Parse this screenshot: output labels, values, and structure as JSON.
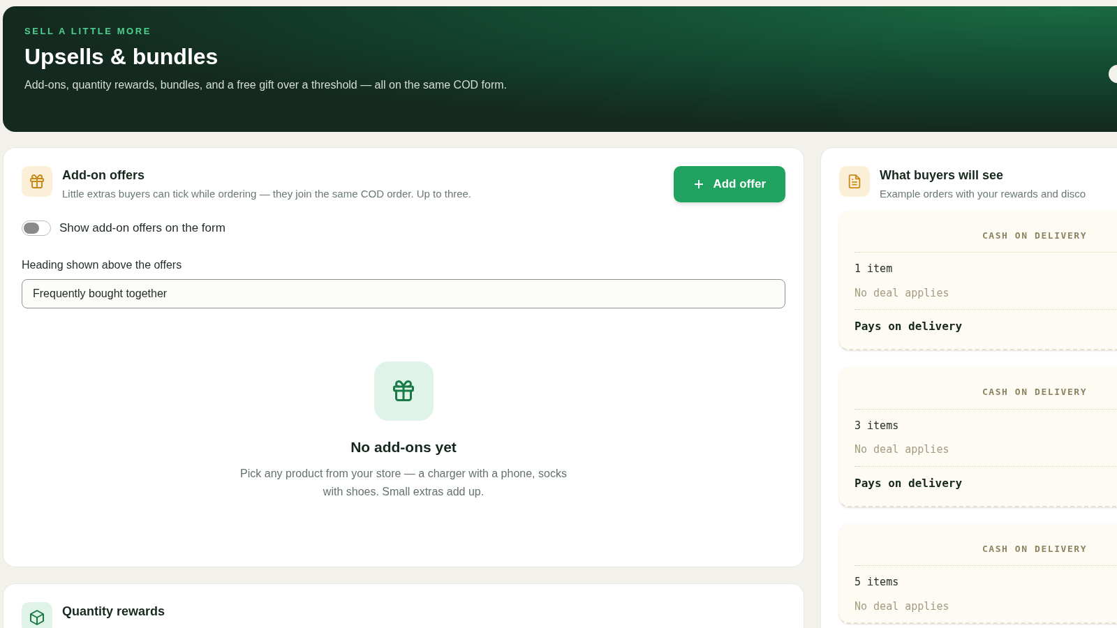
{
  "hero": {
    "eyebrow": "SELL A LITTLE MORE",
    "title": "Upsells & bundles",
    "description": "Add-ons, quantity rewards, bundles, and a free gift over a threshold — all on the same COD form."
  },
  "addon_offers": {
    "title": "Add-on offers",
    "subtitle": "Little extras buyers can tick while ordering — they join the same COD order. Up to three.",
    "add_button": "Add offer",
    "toggle": {
      "label": "Show add-on offers on the form",
      "on": false
    },
    "heading_field": {
      "label": "Heading shown above the offers",
      "value": "Frequently bought together"
    },
    "empty_state": {
      "title": "No add-ons yet",
      "text": "Pick any product from your store — a charger with a phone, socks with shoes. Small extras add up."
    }
  },
  "quantity_rewards": {
    "title": "Quantity rewards"
  },
  "preview": {
    "title": "What buyers will see",
    "subtitle": "Example orders with your rewards and disco",
    "receipts": [
      {
        "header": "CASH ON DELIVERY",
        "items": "1 item",
        "deal": "No deal applies",
        "total": "Pays on delivery"
      },
      {
        "header": "CASH ON DELIVERY",
        "items": "3 items",
        "deal": "No deal applies",
        "total": "Pays on delivery"
      },
      {
        "header": "CASH ON DELIVERY",
        "items": "5 items",
        "deal": "No deal applies"
      }
    ]
  }
}
